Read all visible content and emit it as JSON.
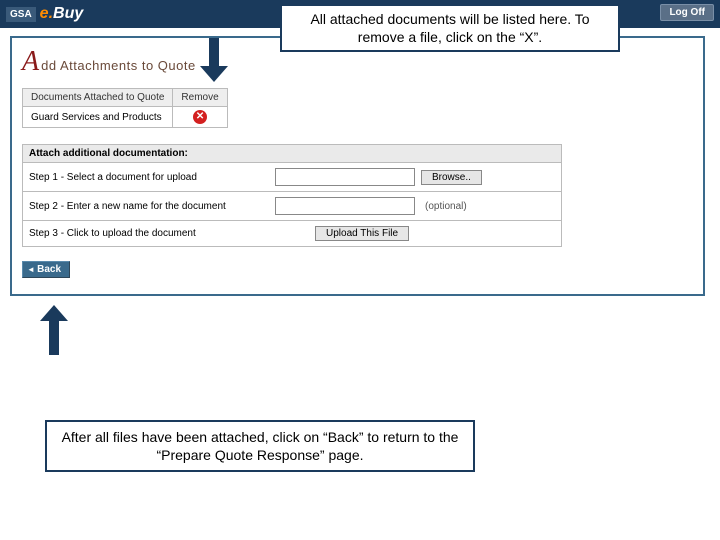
{
  "header": {
    "brand_prefix": "GSA",
    "brand_e": "e.",
    "brand_rest": "Buy",
    "logoff": "Log Off"
  },
  "callouts": {
    "top": "All attached documents will be listed here. To remove a file, click on the “X”.",
    "bottom": "After all files have been attached, click on “Back” to return to the “Prepare Quote Response” page."
  },
  "page": {
    "title_rest": "dd Attachments to Quote"
  },
  "attachments": {
    "col_doc": "Documents Attached to Quote",
    "col_remove": "Remove",
    "rows": [
      {
        "name": "Guard Services and Products"
      }
    ]
  },
  "upload": {
    "header": "Attach additional documentation:",
    "step1_label": "Step 1 - Select a document for upload",
    "step1_browse": "Browse..",
    "step2_label": "Step 2 - Enter a new name for the document",
    "step2_optional": "(optional)",
    "step3_label": "Step 3 - Click to upload the document",
    "step3_button": "Upload This File"
  },
  "buttons": {
    "back": "Back"
  }
}
